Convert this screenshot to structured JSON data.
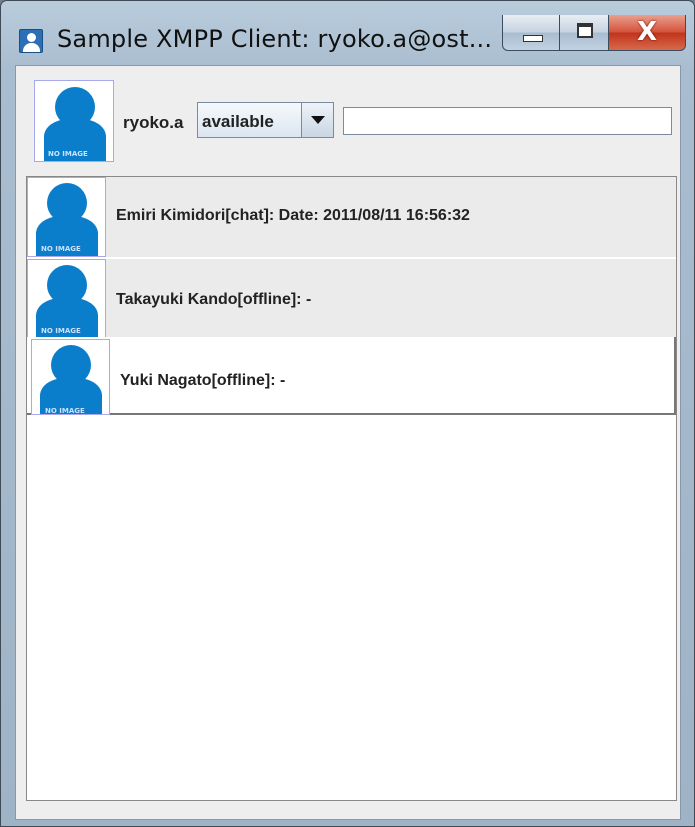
{
  "window": {
    "title": "Sample XMPP Client: ryoko.a@ost...",
    "minimize_icon": "minimize-icon",
    "maximize_icon": "maximize-icon",
    "close_glyph": "X"
  },
  "header": {
    "username": "ryoko.a",
    "status_selected": "available",
    "status_message": "",
    "avatar_text": "NO IMAGE"
  },
  "roster": {
    "items": [
      {
        "label": "Emiri Kimidori[chat]: Date: 2011/08/11 16:56:32",
        "avatar_text": "NO IMAGE"
      },
      {
        "label": "Takayuki Kando[offline]: -",
        "avatar_text": "NO IMAGE"
      },
      {
        "label": "Yuki Nagato[offline]: -",
        "avatar_text": "NO IMAGE"
      }
    ]
  },
  "colors": {
    "avatar_blue": "#0b7ecb",
    "selected_row": "#ebebeb",
    "close_red": "#c0341c"
  }
}
